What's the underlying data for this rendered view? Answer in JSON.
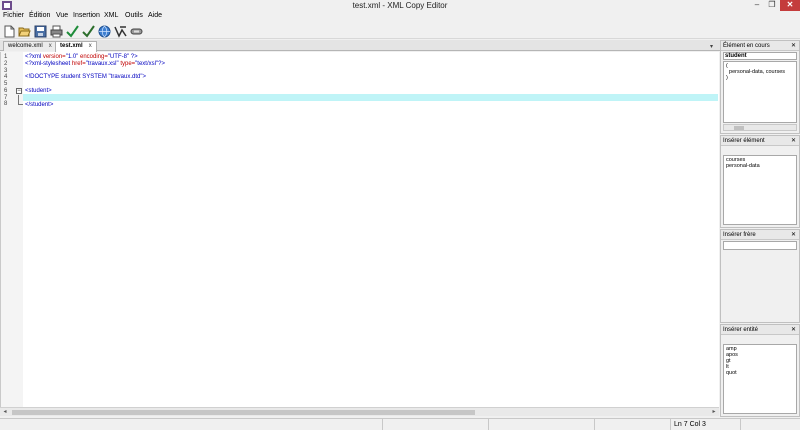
{
  "window": {
    "title": "test.xml - XML Copy Editor",
    "minimize": "–",
    "maximize": "❐",
    "close": "✕"
  },
  "menu": [
    {
      "label": "Fichier"
    },
    {
      "label": "Édition"
    },
    {
      "label": "Vue"
    },
    {
      "label": "Insertion"
    },
    {
      "label": "XML"
    },
    {
      "label": "Outils"
    },
    {
      "label": "Aide"
    }
  ],
  "toolbar": [
    {
      "icon": "new-document-icon"
    },
    {
      "icon": "open-folder-icon"
    },
    {
      "icon": "save-icon"
    },
    {
      "icon": "print-icon"
    },
    {
      "icon": "check-well-formed-icon"
    },
    {
      "icon": "validate-icon"
    },
    {
      "icon": "browser-globe-icon"
    },
    {
      "icon": "xpath-icon"
    },
    {
      "icon": "link-icon"
    }
  ],
  "tabs": [
    {
      "label": "welcome.xml",
      "active": false,
      "close": "x"
    },
    {
      "label": "test.xml",
      "active": true,
      "close": "x"
    }
  ],
  "tab_dropdown": "▾",
  "editor": {
    "line_numbers": [
      "1",
      "2",
      "3",
      "4",
      "5",
      "6",
      "7",
      "8"
    ],
    "fold_marker": "−",
    "lines": [
      {
        "a": "<?xml ",
        "b": "version=",
        "c": "\"1.0\" ",
        "d": "encoding=",
        "e": "\"UTF-8\" ",
        "f": "?>"
      },
      {
        "a": "<?xml-stylesheet ",
        "b": "href=",
        "c": "\"travaux.xsl\" ",
        "d": "type=",
        "e": "\"text/xsl\"",
        "f": "?>"
      },
      {
        "text": ""
      },
      {
        "text": "<!DOCTYPE student SYSTEM \"travaux.dtd\">"
      },
      {
        "text": ""
      },
      {
        "text": "<student>"
      },
      {
        "text": ""
      },
      {
        "text": "</student>"
      }
    ]
  },
  "panes": {
    "current_element": {
      "title": "Élément en cours",
      "close": "✕",
      "input": "student",
      "content": [
        "(",
        "  personal-data, courses",
        ")"
      ]
    },
    "insert_element": {
      "title": "Insérer élément",
      "close": "✕",
      "items": [
        "courses",
        "personal-data"
      ]
    },
    "insert_sibling": {
      "title": "Insérer frère",
      "close": "✕"
    },
    "insert_entity": {
      "title": "Insérer entité",
      "close": "✕",
      "items": [
        "amp",
        "apos",
        "gt",
        "lt",
        "quot"
      ]
    }
  },
  "status": {
    "position": "Ln 7 Col 3"
  }
}
